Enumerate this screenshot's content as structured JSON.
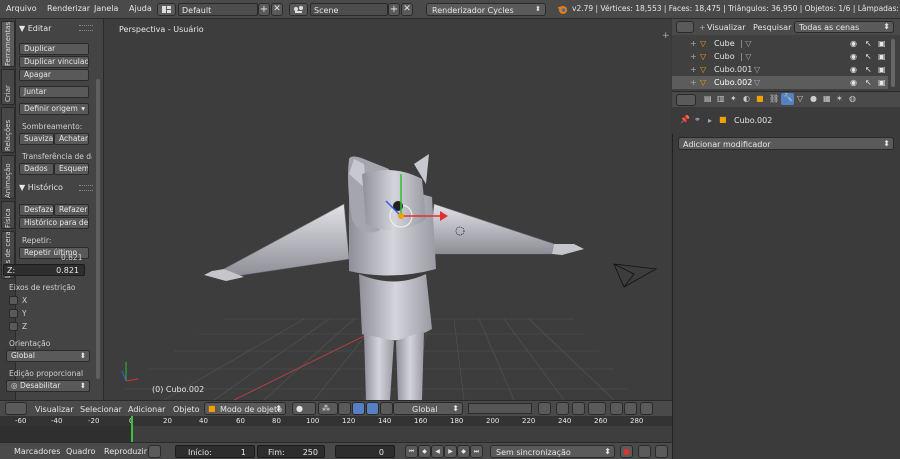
{
  "topbar": {
    "menus": [
      "Arquivo",
      "Renderizar",
      "Janela",
      "Ajuda"
    ],
    "layout": "Default",
    "scene": "Scene",
    "engine": "Renderizador Cycles",
    "stats": "v2.79 | Vértices: 18,553 | Faces: 18,475 | Triângulos: 36,950 | Objetos: 1/6 | Lâmpadas: 0/1"
  },
  "left_tabs": [
    "Ferramentas",
    "Criar",
    "Relações",
    "Animação",
    "Física",
    "Lápis de cera"
  ],
  "tool_panel": {
    "edit_header": "Editar",
    "duplicate": "Duplicar",
    "duplicate_linked": "Duplicar vinculado",
    "delete": "Apagar",
    "join": "Juntar",
    "set_origin": "Definir origem",
    "shading_label": "Sombreamento:",
    "smooth": "Suavizar",
    "flat": "Achatar",
    "data_transfer_label": "Transferência de dados:",
    "data": "Dados",
    "layout_btn": "Esquem",
    "history_header": "Histórico",
    "undo": "Desfazer",
    "redo": "Refazer",
    "undo_history": "Histórico para desfazer",
    "repeat_label": "Repetir:",
    "repeat_last": "Repetir último",
    "y_value": "0.821",
    "z_label": "Z:",
    "z_value": "0.821",
    "constraint_axes": "Eixos de restrição",
    "axis_x": "X",
    "axis_y": "Y",
    "axis_z": "Z",
    "orientation_label": "Orientação",
    "orientation_value": "Global",
    "proportional_label": "Edição proporcional",
    "proportional_value": "Desabilitar"
  },
  "viewport": {
    "view_label": "Perspectiva - Usuário",
    "object_label": "(0) Cubo.002"
  },
  "outliner": {
    "menu_view": "Visualizar",
    "menu_search": "Pesquisar",
    "scene_filter": "Todas as cenas",
    "items": [
      "Cube",
      "Cubo",
      "Cubo.001",
      "Cubo.002"
    ]
  },
  "properties": {
    "object_name": "Cubo.002",
    "add_modifier": "Adicionar modificador"
  },
  "view_header": {
    "menus": [
      "Visualizar",
      "Selecionar",
      "Adicionar",
      "Objeto"
    ],
    "mode": "Modo de objeto",
    "orientation": "Global"
  },
  "timeline": {
    "ticks": [
      "-60",
      "-40",
      "-20",
      "0",
      "20",
      "40",
      "60",
      "80",
      "100",
      "120",
      "140",
      "160",
      "180",
      "200",
      "220",
      "240",
      "260",
      "280"
    ],
    "current_frame_value": 0
  },
  "bottom": {
    "menus": [
      "Marcadores",
      "Quadro",
      "Reproduzir"
    ],
    "start_label": "Início:",
    "start_value": "1",
    "end_label": "Fim:",
    "end_value": "250",
    "current_frame": "0",
    "sync": "Sem sincronização"
  },
  "colors": {
    "accent_blue": "#5680c2",
    "selected_orange": "#f0a000",
    "playhead_green": "#3fbf3f"
  }
}
